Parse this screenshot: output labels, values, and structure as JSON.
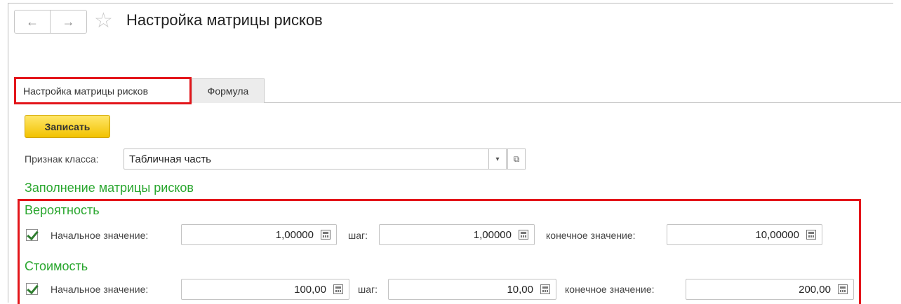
{
  "header": {
    "title": "Настройка матрицы рисков",
    "back_icon": "←",
    "forward_icon": "→",
    "star_icon": "☆"
  },
  "tabs": [
    {
      "label": "Настройка матрицы рисков",
      "active": true
    },
    {
      "label": "Формула",
      "active": false
    }
  ],
  "toolbar": {
    "save_label": "Записать"
  },
  "class_field": {
    "label": "Признак класса:",
    "value": "Табличная часть",
    "dropdown_icon": "▾",
    "open_icon": "⧉"
  },
  "fill_section": {
    "title": "Заполнение матрицы рисков",
    "probability": {
      "title": "Вероятность",
      "enabled": true,
      "start_label": "Начальное значение:",
      "start_value": "1,00000",
      "step_label": "шаг:",
      "step_value": "1,00000",
      "end_label": "конечное значение:",
      "end_value": "10,00000"
    },
    "cost": {
      "title": "Стоимость",
      "enabled": true,
      "start_label": "Начальное значение:",
      "start_value": "100,00",
      "step_label": "шаг:",
      "step_value": "10,00",
      "end_label": "конечное значение:",
      "end_value": "200,00"
    }
  },
  "colors": {
    "accent_green": "#2aa72f",
    "highlight_red": "#e3151a",
    "save_yellow": "#f2c200"
  }
}
